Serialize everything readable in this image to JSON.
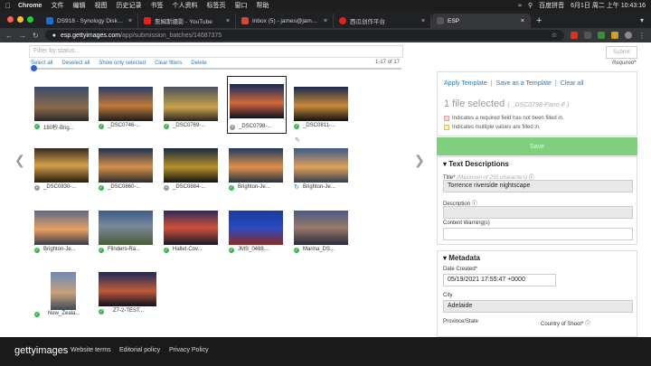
{
  "menubar": {
    "app": "Chrome",
    "items": [
      "文件",
      "编辑",
      "视图",
      "历史记录",
      "书签",
      "个人资料",
      "标签页",
      "窗口",
      "帮助"
    ],
    "ime": "百度拼音",
    "clock": "6月1日 周二 上午 10:43:16"
  },
  "tabs": [
    {
      "label": "DS918 - Synology DiskStation",
      "color": "#1f6fd1"
    },
    {
      "label": "詹姆斯摄影 - YouTube",
      "color": "#e62117"
    },
    {
      "label": "Inbox (5) - james@jamesphot",
      "color": "#d44638"
    },
    {
      "label": "西瓜创作平台",
      "color": "#e62117"
    },
    {
      "label": "ESP",
      "color": "#555555"
    }
  ],
  "address": {
    "host": "esp.gettyimages.com",
    "path": "/app/submission_batches/14687375"
  },
  "toolbar": {
    "filter_placeholder": "Filter by status...",
    "select_all": "Select all",
    "deselect_all": "Deselect all",
    "show_only_selected": "Show only selected",
    "clear_filters": "Clear filters",
    "delete": "Delete",
    "count": "1-17 of 17"
  },
  "thumbnails": [
    {
      "name": "180秒-Brig...",
      "status": "check"
    },
    {
      "name": "_DSC0746-...",
      "status": "check"
    },
    {
      "name": "_DSC0769-...",
      "status": "check"
    },
    {
      "name": "_DSC0798-...",
      "status": "gray"
    },
    {
      "name": "_DSC0811-...",
      "status": "check"
    },
    {
      "name": "_DSC0830-...",
      "status": "gray"
    },
    {
      "name": "_DSC0860-...",
      "status": "check"
    },
    {
      "name": "_DSC0884-...",
      "status": "gray"
    },
    {
      "name": "Brighton-Je...",
      "status": "check"
    },
    {
      "name": "Brighton-Je...",
      "status": "sync"
    },
    {
      "name": "Brighton-Je...",
      "status": "check"
    },
    {
      "name": "Flinders-Ra...",
      "status": "check"
    },
    {
      "name": "Hallet-Cov...",
      "status": "check"
    },
    {
      "name": "JMS_0488....",
      "status": "check"
    },
    {
      "name": "Marina_DS...",
      "status": "check"
    },
    {
      "name": "New_Zeala...",
      "status": "check"
    },
    {
      "name": "Z7-2-TEST...",
      "status": "check"
    }
  ],
  "panel": {
    "submit": "Submit",
    "required": "Required*",
    "apply_template": "Apply Template",
    "save_template": "Save as a Template",
    "clear_all": "Clear all",
    "files_selected": "1 file selected",
    "file_name": "( _DSC0798-Pano-F )",
    "legend_required": "Indicates a required field has not been filled in.",
    "legend_multiple": "Indicates multiple values are filled in.",
    "save": "Save",
    "text_section": "Text Descriptions",
    "title_label": "Title*",
    "title_hint": "(Maximum of 255 characters)",
    "title_value": "Torrence riverside nightscape",
    "description_label": "Description",
    "content_warning_label": "Content Warning(s)",
    "metadata_section": "Metadata",
    "date_created_label": "Date Created*",
    "date_created_value": "05/19/2021 17:55:47 +0000",
    "city_label": "City",
    "city_value": "Adelaide",
    "province_label": "Province/State",
    "country_label": "Country of Shoot*"
  },
  "footer": {
    "logo": "gettyimages",
    "links": [
      "Website terms",
      "Editorial policy",
      "Privacy Policy"
    ]
  },
  "colors": {
    "accent_link": "#2b7bb9",
    "save_green": "#7fcf7f",
    "status_green": "#3cb54a"
  }
}
